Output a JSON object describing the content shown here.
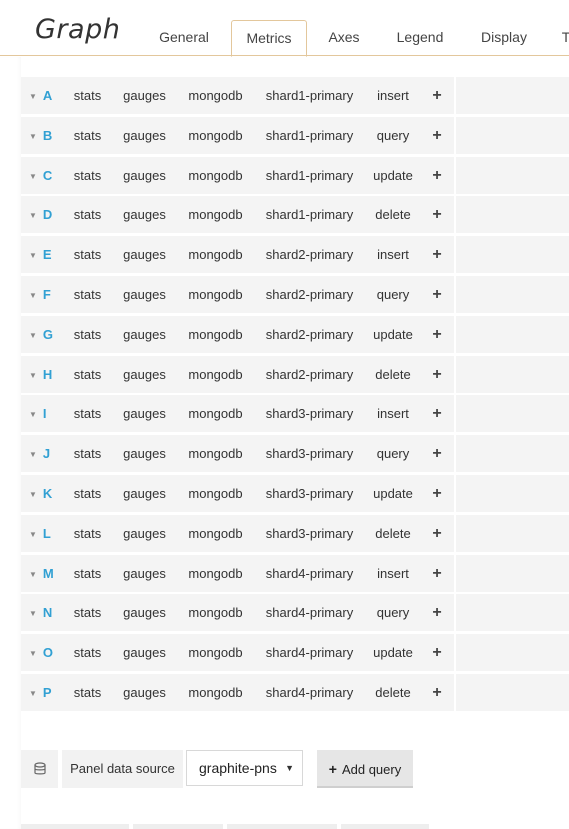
{
  "header": {
    "title": "Graph",
    "tabs": [
      "General",
      "Metrics",
      "Axes",
      "Legend",
      "Display",
      "T"
    ],
    "active_tab": "Metrics"
  },
  "queries": [
    {
      "letter": "A",
      "parts": [
        "stats",
        "gauges",
        "mongodb",
        "shard1-primary",
        "insert"
      ]
    },
    {
      "letter": "B",
      "parts": [
        "stats",
        "gauges",
        "mongodb",
        "shard1-primary",
        "query"
      ]
    },
    {
      "letter": "C",
      "parts": [
        "stats",
        "gauges",
        "mongodb",
        "shard1-primary",
        "update"
      ]
    },
    {
      "letter": "D",
      "parts": [
        "stats",
        "gauges",
        "mongodb",
        "shard1-primary",
        "delete"
      ]
    },
    {
      "letter": "E",
      "parts": [
        "stats",
        "gauges",
        "mongodb",
        "shard2-primary",
        "insert"
      ]
    },
    {
      "letter": "F",
      "parts": [
        "stats",
        "gauges",
        "mongodb",
        "shard2-primary",
        "query"
      ]
    },
    {
      "letter": "G",
      "parts": [
        "stats",
        "gauges",
        "mongodb",
        "shard2-primary",
        "update"
      ]
    },
    {
      "letter": "H",
      "parts": [
        "stats",
        "gauges",
        "mongodb",
        "shard2-primary",
        "delete"
      ]
    },
    {
      "letter": "I",
      "parts": [
        "stats",
        "gauges",
        "mongodb",
        "shard3-primary",
        "insert"
      ]
    },
    {
      "letter": "J",
      "parts": [
        "stats",
        "gauges",
        "mongodb",
        "shard3-primary",
        "query"
      ]
    },
    {
      "letter": "K",
      "parts": [
        "stats",
        "gauges",
        "mongodb",
        "shard3-primary",
        "update"
      ]
    },
    {
      "letter": "L",
      "parts": [
        "stats",
        "gauges",
        "mongodb",
        "shard3-primary",
        "delete"
      ]
    },
    {
      "letter": "M",
      "parts": [
        "stats",
        "gauges",
        "mongodb",
        "shard4-primary",
        "insert"
      ]
    },
    {
      "letter": "N",
      "parts": [
        "stats",
        "gauges",
        "mongodb",
        "shard4-primary",
        "query"
      ]
    },
    {
      "letter": "O",
      "parts": [
        "stats",
        "gauges",
        "mongodb",
        "shard4-primary",
        "update"
      ]
    },
    {
      "letter": "P",
      "parts": [
        "stats",
        "gauges",
        "mongodb",
        "shard4-primary",
        "delete"
      ]
    }
  ],
  "add_segment_symbol": "+",
  "footer": {
    "datasource_icon": "database-icon",
    "datasource_label": "Panel data source",
    "datasource_value": "graphite-pns",
    "add_query_label": "Add query",
    "add_query_symbol": "+"
  },
  "colors": {
    "accent": "#31a0d3",
    "tab_border": "#e3c79c",
    "segment_bg": "#f4f4f4"
  }
}
